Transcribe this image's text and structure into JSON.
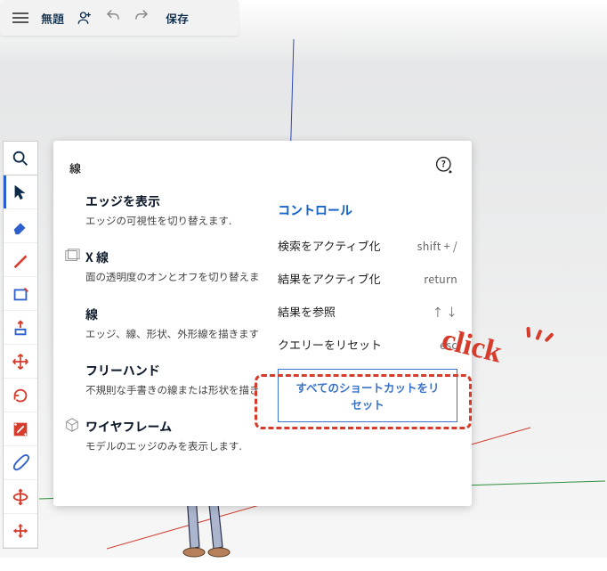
{
  "topbar": {
    "title": "無題",
    "save": "保存"
  },
  "panel": {
    "search_title": "線",
    "items": [
      {
        "title": "エッジを表示",
        "desc": "エッジの可視性を切り替えます."
      },
      {
        "title": "X 線",
        "desc": "面の透明度のオンとオフを切り替えます."
      },
      {
        "title": "線",
        "desc": "エッジ、線、形状、外形線を描きます."
      },
      {
        "title": "フリーハンド",
        "desc": "不規則な手書きの線または形状を描きます."
      },
      {
        "title": "ワイヤフレーム",
        "desc": "モデルのエッジのみを表示します."
      }
    ]
  },
  "controls": {
    "title": "コントロール",
    "rows": [
      {
        "label": "検索をアクティブ化",
        "key": "shift + /"
      },
      {
        "label": "結果をアクティブ化",
        "key": "return"
      },
      {
        "label": "結果を参照",
        "key": "↑   ↓"
      },
      {
        "label": "クエリーをリセット",
        "key": "esc"
      }
    ],
    "reset_button": "すべてのショートカットをリセット"
  },
  "click_label": "click"
}
